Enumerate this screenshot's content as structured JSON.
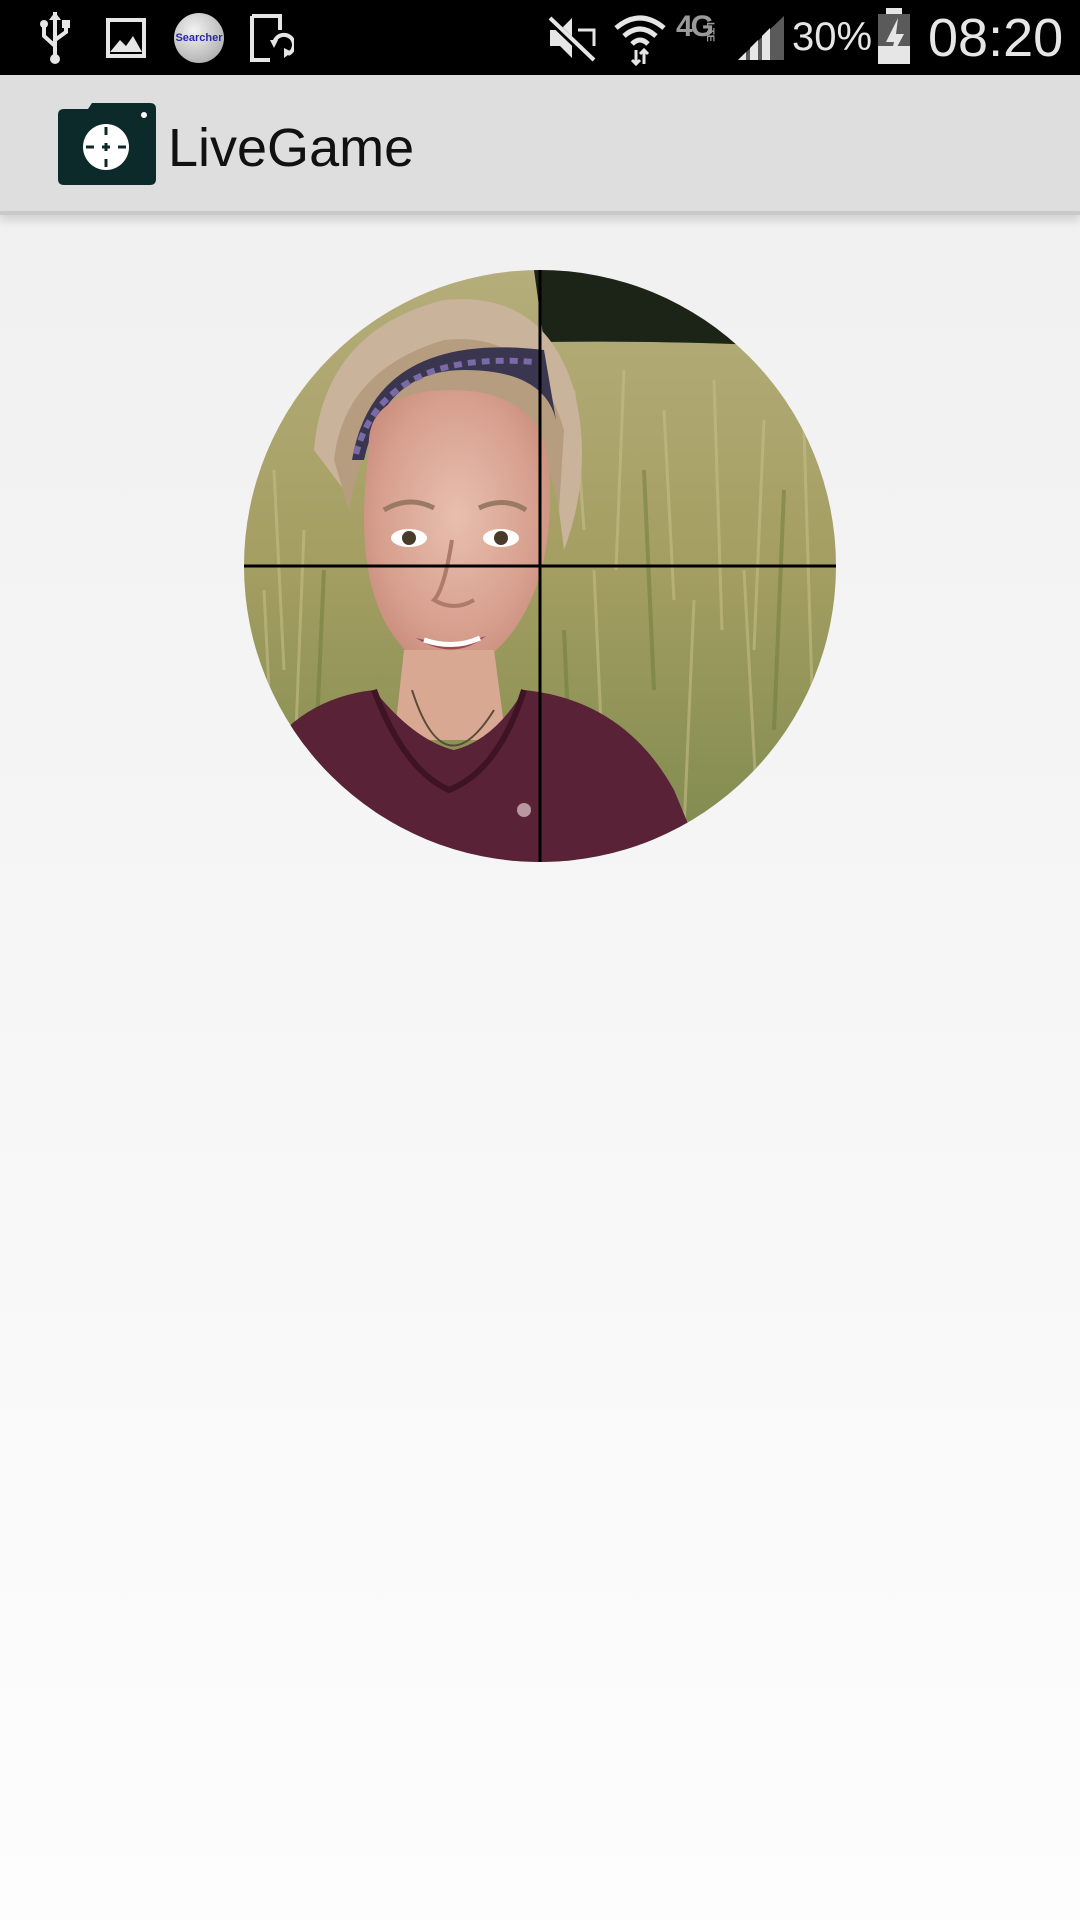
{
  "status_bar": {
    "icons": [
      "usb-icon",
      "gallery-icon",
      "searcher-app-icon",
      "screen-rotate-icon",
      "mute-icon",
      "wifi-icon",
      "network-4g-lte-icon",
      "signal-icon",
      "battery-charging-icon"
    ],
    "searcher_label": "Searcher",
    "network_label": "4G",
    "network_sub": "LTE",
    "battery_percent": "30%",
    "time": "08:20"
  },
  "action_bar": {
    "app_icon": "camera-crosshair-icon",
    "title": "LiveGame"
  },
  "viewfinder": {
    "content": "camera-preview",
    "overlay": "crosshair"
  },
  "colors": {
    "status_bar_bg": "#000000",
    "action_bar_bg": "#dedede",
    "app_icon": "#0d2a2a"
  }
}
